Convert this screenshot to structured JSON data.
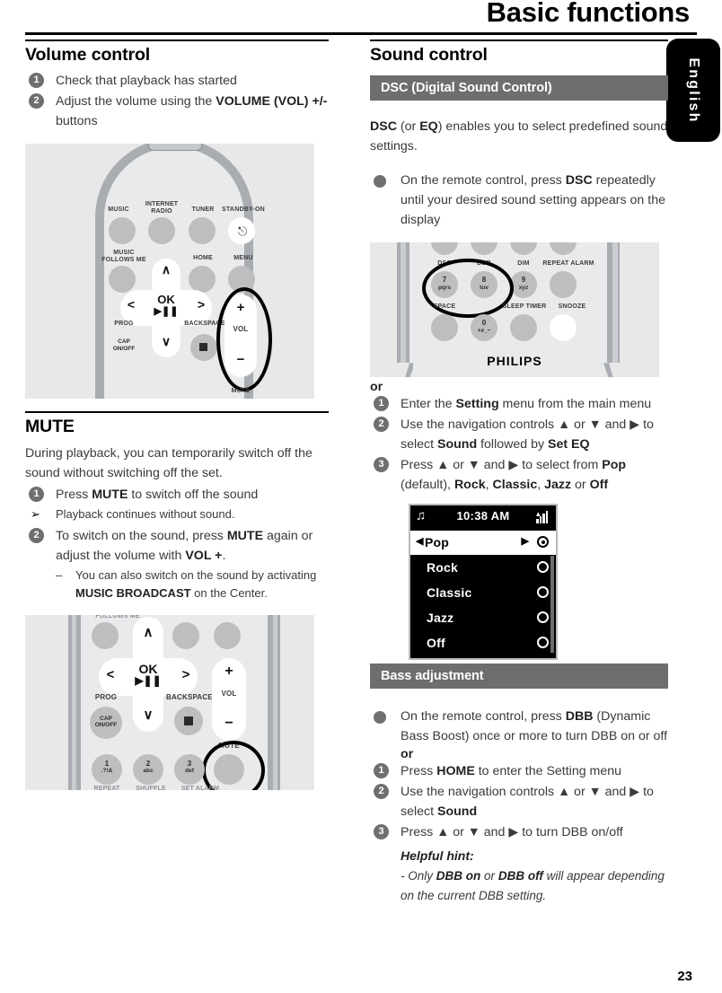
{
  "header": {
    "title": "Basic functions",
    "language_tab": "English",
    "page_number": "23"
  },
  "left_column": {
    "volume_section": {
      "heading": "Volume control",
      "steps": [
        {
          "num": "1",
          "html": "Check that playback has started"
        },
        {
          "num": "2",
          "html": "Adjust the volume using the <b>VOLUME (VOL) +/-</b> buttons"
        }
      ]
    },
    "remote_figure_1": {
      "caption": "",
      "buttons": [
        "MUSIC",
        "INTERNET RADIO",
        "TUNER",
        "STANDBY-ON",
        "MUSIC FOLLOWS ME",
        "HOME",
        "MENU",
        "OK",
        "PROG",
        "BACKSPACE",
        "VOL",
        "CAP ON/OFF",
        "MUTE"
      ],
      "highlight": "VOL +/-"
    },
    "mute_section": {
      "heading": "MUTE",
      "intro": "During playback, you can temporarily switch off the sound without switching off the set.",
      "steps": [
        {
          "num": "1",
          "html": "Press <b>MUTE</b> to switch off the sound"
        },
        {
          "num": "2",
          "html": "To switch on the sound, press <b>MUTE</b> again or adjust the volume with <b>VOL +</b>."
        }
      ],
      "arrow_note": "Playback continues without sound.",
      "dash_note": "You can also switch on the sound by activating <b>MUSIC BROADCAST</b> on the Center."
    },
    "remote_figure_2": {
      "buttons": [
        "OK",
        "PROG",
        "BACKSPACE",
        "VOL",
        "CAP ON/OFF",
        "MUTE",
        "1 .?!&",
        "2 abc",
        "3 def"
      ],
      "highlight": "MUTE"
    }
  },
  "right_column": {
    "sound_section": {
      "heading": "Sound control",
      "band": "DSC (Digital Sound Control)",
      "intro_html": "<b>DSC</b> (or <b>EQ</b>) enables you to select predefined sound settings.",
      "bullet_html": "On the remote control, press <b>DSC</b> repeatedly until your desired sound setting appears on the display",
      "or": "or",
      "steps": [
        {
          "num": "1",
          "html": "Enter the <b>Setting</b> menu from the main menu"
        },
        {
          "num": "2",
          "html": "Use the navigation controls ▲ or ▼ and ▶ to select <b>Sound</b> followed by <b>Set EQ</b>"
        },
        {
          "num": "3",
          "html": "Press ▲ or ▼ and ▶ to select from <b>Pop</b> (default), <b>Rock</b>, <b>Classic</b>, <b>Jazz</b> or <b>Off</b>"
        }
      ]
    },
    "remote_figure_3": {
      "button_labels": [
        "DSC",
        "DBB",
        "DIM",
        "REPEAT ALARM",
        "SPACE",
        "SLEEP TIMER",
        "SNOOZE"
      ],
      "keys": [
        "7 pqrs",
        "8 tuv",
        "9 xyz",
        "0 +#_~"
      ],
      "brand": "PHILIPS",
      "highlight": "DSC / DBB"
    },
    "lcd_screen": {
      "status_time": "10:38 AM",
      "status_icon_left": "music-note-icon",
      "status_icon_right": "signal-icon",
      "items": [
        {
          "label": "Pop",
          "selected": true
        },
        {
          "label": "Rock",
          "selected": false
        },
        {
          "label": "Classic",
          "selected": false
        },
        {
          "label": "Jazz",
          "selected": false
        },
        {
          "label": "Off",
          "selected": false
        }
      ]
    },
    "bass_section": {
      "band": "Bass adjustment",
      "bullet_html": "On the remote control, press <b>DBB</b> (Dynamic Bass Boost) once or more to turn DBB on or off",
      "or": "or",
      "steps": [
        {
          "num": "1",
          "html": "Press <b>HOME</b> to enter the Setting menu"
        },
        {
          "num": "2",
          "html": "Use the navigation controls ▲ or ▼ and ▶ to select <b>Sound</b>"
        },
        {
          "num": "3",
          "html": "Press ▲ or ▼ and ▶ to turn DBB on/off"
        }
      ],
      "hint_title": "Helpful hint:",
      "hint_html": "- <i>Only</i> <b>DBB on</b> <i>or</i> <b>DBB off</b> <i>will appear depending on the current DBB setting.</i>"
    }
  },
  "colors": {
    "band_gray": "#6e6e6e",
    "bullet_gray": "#6f6f6f",
    "figure_bg": "#e8e8e8",
    "remote_body": "#e9eaec",
    "button_gray": "#bcbec0",
    "text": "#3a3a3a"
  }
}
